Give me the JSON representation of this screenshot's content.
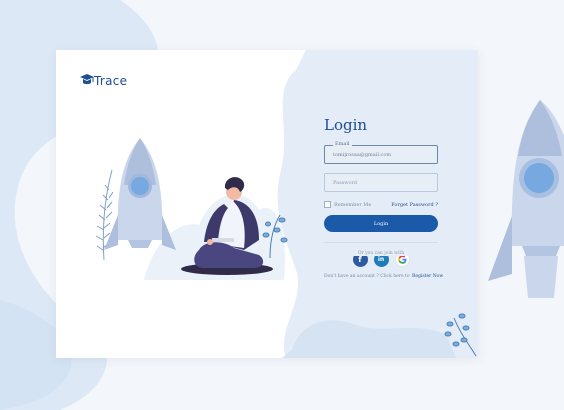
{
  "app": {
    "logo_text": "Trace"
  },
  "login": {
    "title": "Login",
    "email_label": "Email",
    "email_value": "tomijrosaa@gmail.com",
    "password_placeholder": "Password",
    "remember_label": "Remember Me",
    "forgot_label": "Forget Password ?",
    "login_button": "Login",
    "divider_text": "Or you can join with",
    "register_prefix": "Don't have an account ? Click here to",
    "register_link": "Register Now"
  },
  "social": [
    {
      "name": "facebook",
      "glyph": "f",
      "color": "#2d5aa0"
    },
    {
      "name": "linkedin",
      "glyph": "in",
      "color": "#1e7cb8"
    },
    {
      "name": "google",
      "glyph": "G",
      "color": "#ea4335"
    }
  ],
  "colors": {
    "primary": "#1b5aa8",
    "title": "#1f4f8f",
    "panel": "#e3ecf7",
    "background": "#f3f6fa"
  },
  "icons": [
    "graduation-cap-icon",
    "rocket-illustration",
    "plant-icon",
    "facebook-icon",
    "linkedin-icon",
    "google-icon"
  ]
}
